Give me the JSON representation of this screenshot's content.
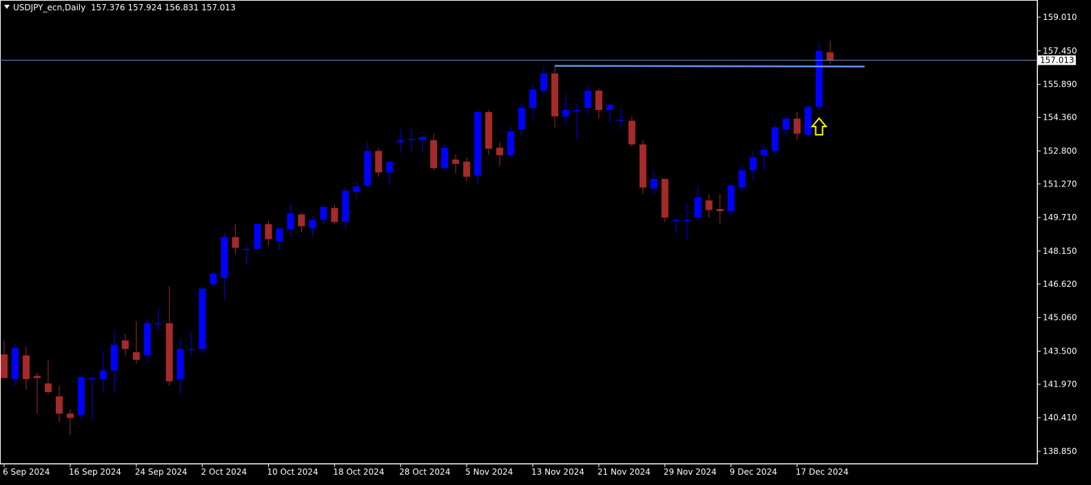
{
  "header": {
    "symbol": "USDJPY_ecn,Daily",
    "ohlc": "157.376 157.924 156.831 157.013"
  },
  "colors": {
    "background": "#000000",
    "bull": "#0000ff",
    "bear": "#a52a2a",
    "axis": "#ffffff",
    "price_line": "#7092be",
    "resistance": "#6495ed",
    "arrow": "#ffff00"
  },
  "chart_data": {
    "type": "candlestick",
    "ylim": [
      138.0,
      159.6
    ],
    "y_ticks": [
      "159.010",
      "157.450",
      "155.890",
      "154.360",
      "152.800",
      "151.270",
      "149.710",
      "148.150",
      "146.620",
      "145.060",
      "143.500",
      "141.970",
      "140.410",
      "138.850"
    ],
    "x_ticks": [
      "6 Sep 2024",
      "16 Sep 2024",
      "24 Sep 2024",
      "2 Oct 2024",
      "10 Oct 2024",
      "18 Oct 2024",
      "28 Oct 2024",
      "5 Nov 2024",
      "13 Nov 2024",
      "21 Nov 2024",
      "29 Nov 2024",
      "9 Dec 2024",
      "17 Dec 2024"
    ],
    "current_price": "157.013",
    "resistance_level": 156.75,
    "arrow_at": "17 Dec 2024",
    "candles": [
      {
        "date": "6 Sep",
        "o": 143.35,
        "h": 144.0,
        "l": 142.7,
        "c": 142.25
      },
      {
        "date": "9 Sep",
        "o": 142.2,
        "h": 143.8,
        "l": 141.9,
        "c": 143.65
      },
      {
        "date": "10 Sep",
        "o": 143.3,
        "h": 143.7,
        "l": 141.7,
        "c": 142.2
      },
      {
        "date": "11 Sep",
        "o": 142.35,
        "h": 142.5,
        "l": 140.6,
        "c": 142.25
      },
      {
        "date": "12 Sep",
        "o": 142.0,
        "h": 143.1,
        "l": 141.5,
        "c": 141.6
      },
      {
        "date": "13 Sep",
        "o": 141.4,
        "h": 141.9,
        "l": 140.2,
        "c": 140.6
      },
      {
        "date": "16 Sep",
        "o": 140.6,
        "h": 140.8,
        "l": 139.6,
        "c": 140.4
      },
      {
        "date": "17 Sep",
        "o": 140.55,
        "h": 142.4,
        "l": 140.3,
        "c": 142.3
      },
      {
        "date": "18 Sep",
        "o": 142.2,
        "h": 142.3,
        "l": 140.3,
        "c": 142.25
      },
      {
        "date": "19 Sep",
        "o": 142.2,
        "h": 143.5,
        "l": 141.6,
        "c": 142.6
      },
      {
        "date": "20 Sep",
        "o": 142.6,
        "h": 144.5,
        "l": 141.6,
        "c": 143.8
      },
      {
        "date": "23 Sep",
        "o": 144.0,
        "h": 144.3,
        "l": 143.3,
        "c": 143.6
      },
      {
        "date": "24 Sep",
        "o": 143.45,
        "h": 144.9,
        "l": 142.9,
        "c": 143.1
      },
      {
        "date": "25 Sep",
        "o": 143.3,
        "h": 145.0,
        "l": 143.0,
        "c": 144.8
      },
      {
        "date": "26 Sep",
        "o": 144.8,
        "h": 145.5,
        "l": 144.4,
        "c": 144.8
      },
      {
        "date": "27 Sep",
        "o": 144.8,
        "h": 146.5,
        "l": 141.9,
        "c": 142.1
      },
      {
        "date": "30 Sep",
        "o": 142.2,
        "h": 144.1,
        "l": 141.5,
        "c": 143.6
      },
      {
        "date": "1 Oct",
        "o": 143.6,
        "h": 144.4,
        "l": 143.3,
        "c": 143.6
      },
      {
        "date": "2 Oct",
        "o": 143.6,
        "h": 146.5,
        "l": 143.4,
        "c": 146.4
      },
      {
        "date": "3 Oct",
        "o": 146.6,
        "h": 147.2,
        "l": 146.5,
        "c": 147.1
      },
      {
        "date": "4 Oct",
        "o": 146.9,
        "h": 149.0,
        "l": 145.9,
        "c": 148.8
      },
      {
        "date": "7 Oct",
        "o": 148.8,
        "h": 149.4,
        "l": 148.0,
        "c": 148.3
      },
      {
        "date": "8 Oct",
        "o": 148.25,
        "h": 148.4,
        "l": 147.5,
        "c": 148.25
      },
      {
        "date": "9 Oct",
        "o": 148.25,
        "h": 149.4,
        "l": 148.2,
        "c": 149.4
      },
      {
        "date": "10 Oct",
        "o": 149.4,
        "h": 149.55,
        "l": 148.4,
        "c": 148.7
      },
      {
        "date": "11 Oct",
        "o": 148.6,
        "h": 149.2,
        "l": 148.2,
        "c": 149.2
      },
      {
        "date": "14 Oct",
        "o": 149.15,
        "h": 150.3,
        "l": 148.9,
        "c": 149.9
      },
      {
        "date": "15 Oct",
        "o": 149.85,
        "h": 149.9,
        "l": 149.0,
        "c": 149.3
      },
      {
        "date": "16 Oct",
        "o": 149.2,
        "h": 149.8,
        "l": 148.8,
        "c": 149.6
      },
      {
        "date": "17 Oct",
        "o": 149.6,
        "h": 150.3,
        "l": 149.4,
        "c": 150.2
      },
      {
        "date": "18 Oct",
        "o": 150.15,
        "h": 150.3,
        "l": 149.4,
        "c": 149.5
      },
      {
        "date": "21 Oct",
        "o": 149.5,
        "h": 151.1,
        "l": 149.2,
        "c": 150.95
      },
      {
        "date": "22 Oct",
        "o": 150.9,
        "h": 151.4,
        "l": 150.6,
        "c": 151.15
      },
      {
        "date": "23 Oct",
        "o": 151.2,
        "h": 153.2,
        "l": 151.1,
        "c": 152.8
      },
      {
        "date": "24 Oct",
        "o": 152.8,
        "h": 152.9,
        "l": 151.6,
        "c": 151.8
      },
      {
        "date": "25 Oct",
        "o": 151.8,
        "h": 152.3,
        "l": 151.3,
        "c": 152.3
      },
      {
        "date": "28 Oct",
        "o": 153.2,
        "h": 153.8,
        "l": 152.7,
        "c": 153.3
      },
      {
        "date": "29 Oct",
        "o": 153.3,
        "h": 153.9,
        "l": 152.8,
        "c": 153.35
      },
      {
        "date": "30 Oct",
        "o": 153.3,
        "h": 153.5,
        "l": 152.7,
        "c": 153.45
      },
      {
        "date": "31 Oct",
        "o": 153.3,
        "h": 153.6,
        "l": 151.9,
        "c": 152.0
      },
      {
        "date": "1 Nov",
        "o": 152.0,
        "h": 153.1,
        "l": 151.9,
        "c": 152.95
      },
      {
        "date": "4 Nov",
        "o": 152.4,
        "h": 152.65,
        "l": 151.75,
        "c": 152.2
      },
      {
        "date": "5 Nov",
        "o": 152.3,
        "h": 152.5,
        "l": 151.4,
        "c": 151.6
      },
      {
        "date": "6 Nov",
        "o": 151.65,
        "h": 154.7,
        "l": 151.3,
        "c": 154.6
      },
      {
        "date": "7 Nov",
        "o": 154.6,
        "h": 154.7,
        "l": 152.6,
        "c": 152.9
      },
      {
        "date": "8 Nov",
        "o": 152.95,
        "h": 153.2,
        "l": 152.1,
        "c": 152.6
      },
      {
        "date": "11 Nov",
        "o": 152.6,
        "h": 154.0,
        "l": 152.6,
        "c": 153.7
      },
      {
        "date": "12 Nov",
        "o": 153.8,
        "h": 155.0,
        "l": 153.5,
        "c": 154.8
      },
      {
        "date": "13 Nov",
        "o": 154.8,
        "h": 156.0,
        "l": 154.3,
        "c": 155.65
      },
      {
        "date": "14 Nov",
        "o": 155.6,
        "h": 156.75,
        "l": 155.4,
        "c": 156.4
      },
      {
        "date": "15 Nov",
        "o": 156.4,
        "h": 156.75,
        "l": 153.9,
        "c": 154.4
      },
      {
        "date": "18 Nov",
        "o": 154.4,
        "h": 155.5,
        "l": 154.0,
        "c": 154.7
      },
      {
        "date": "19 Nov",
        "o": 154.65,
        "h": 155.0,
        "l": 153.3,
        "c": 154.7
      },
      {
        "date": "20 Nov",
        "o": 154.8,
        "h": 155.9,
        "l": 154.5,
        "c": 155.6
      },
      {
        "date": "21 Nov",
        "o": 155.6,
        "h": 155.7,
        "l": 154.3,
        "c": 154.7
      },
      {
        "date": "22 Nov",
        "o": 154.7,
        "h": 155.0,
        "l": 154.1,
        "c": 154.95
      },
      {
        "date": "25 Nov",
        "o": 154.25,
        "h": 154.8,
        "l": 153.8,
        "c": 154.25
      },
      {
        "date": "26 Nov",
        "o": 154.2,
        "h": 154.4,
        "l": 153.0,
        "c": 153.1
      },
      {
        "date": "27 Nov",
        "o": 153.1,
        "h": 153.3,
        "l": 150.8,
        "c": 151.1
      },
      {
        "date": "28 Nov",
        "o": 151.05,
        "h": 151.9,
        "l": 150.8,
        "c": 151.5
      },
      {
        "date": "29 Nov",
        "o": 151.5,
        "h": 151.5,
        "l": 149.5,
        "c": 149.7
      },
      {
        "date": "2 Dec",
        "o": 149.6,
        "h": 149.7,
        "l": 149.0,
        "c": 149.6
      },
      {
        "date": "3 Dec",
        "o": 149.6,
        "h": 150.4,
        "l": 148.65,
        "c": 149.6
      },
      {
        "date": "4 Dec",
        "o": 149.7,
        "h": 151.2,
        "l": 149.6,
        "c": 150.65
      },
      {
        "date": "5 Dec",
        "o": 150.5,
        "h": 150.8,
        "l": 149.7,
        "c": 150.05
      },
      {
        "date": "6 Dec",
        "o": 150.1,
        "h": 150.8,
        "l": 149.4,
        "c": 150.0
      },
      {
        "date": "9 Dec",
        "o": 150.0,
        "h": 151.3,
        "l": 149.8,
        "c": 151.2
      },
      {
        "date": "10 Dec",
        "o": 151.1,
        "h": 152.1,
        "l": 150.9,
        "c": 151.9
      },
      {
        "date": "11 Dec",
        "o": 151.9,
        "h": 152.8,
        "l": 151.4,
        "c": 152.5
      },
      {
        "date": "12 Dec",
        "o": 152.6,
        "h": 153.1,
        "l": 151.9,
        "c": 152.85
      },
      {
        "date": "13 Dec",
        "o": 152.8,
        "h": 154.0,
        "l": 152.6,
        "c": 153.9
      },
      {
        "date": "16 Dec",
        "o": 153.8,
        "h": 154.4,
        "l": 153.5,
        "c": 154.3
      },
      {
        "date": "17 Dec",
        "o": 154.3,
        "h": 154.6,
        "l": 153.3,
        "c": 153.6
      },
      {
        "date": "18 Dec",
        "o": 153.55,
        "h": 154.9,
        "l": 153.5,
        "c": 154.85
      },
      {
        "date": "19 Dec",
        "o": 154.85,
        "h": 157.85,
        "l": 154.7,
        "c": 157.45
      },
      {
        "date": "20 Dec",
        "o": 157.376,
        "h": 157.924,
        "l": 156.831,
        "c": 157.013
      }
    ]
  }
}
